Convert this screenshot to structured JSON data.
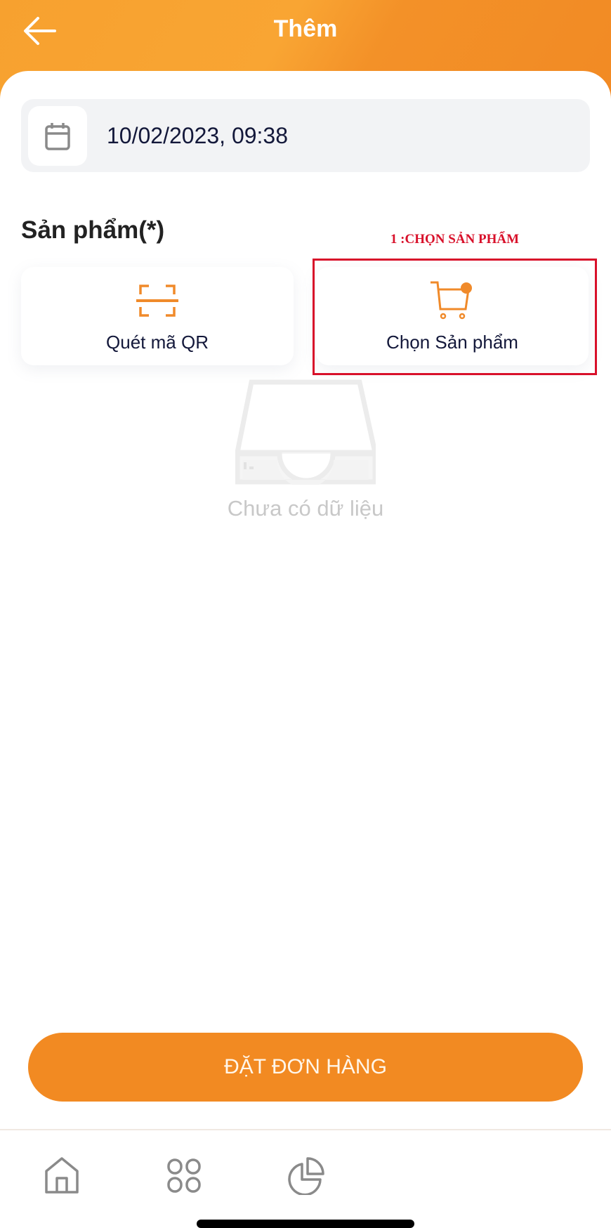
{
  "header": {
    "title": "Thêm"
  },
  "date_field": {
    "value": "10/02/2023, 09:38"
  },
  "products": {
    "section_label": "Sản phẩm(*)",
    "annotation": "1 :CHỌN SẢN PHẨM",
    "scan_qr_label": "Quét mã QR",
    "choose_product_label": "Chọn Sản phẩm",
    "empty_text": "Chưa có dữ liệu"
  },
  "actions": {
    "order_label": "ĐẶT ĐƠN HÀNG"
  },
  "colors": {
    "accent": "#f28a22",
    "annotation": "#d8102a",
    "text": "#13183a"
  }
}
